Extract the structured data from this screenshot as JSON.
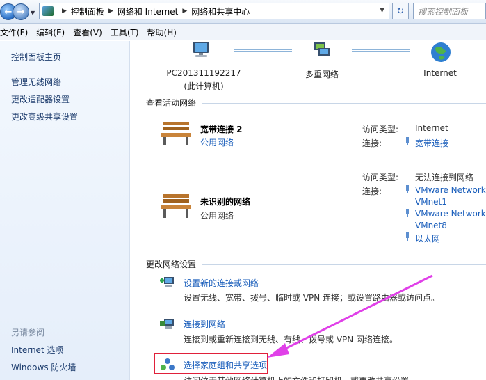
{
  "address_bar": {
    "breadcrumbs": [
      "控制面板",
      "网络和 Internet",
      "网络和共享中心"
    ],
    "search_placeholder": "搜索控制面板"
  },
  "menu": [
    "文件(F)",
    "编辑(E)",
    "查看(V)",
    "工具(T)",
    "帮助(H)"
  ],
  "sidebar": {
    "links": [
      "控制面板主页",
      "管理无线网络",
      "更改适配器设置",
      "更改高级共享设置"
    ],
    "see_also_header": "另请参阅",
    "see_also": [
      "Internet 选项",
      "Windows 防火墙"
    ]
  },
  "network_map": {
    "computer_name": "PC201311192217",
    "computer_sub": "(此计算机)",
    "middle_label": "多重网络",
    "internet_label": "Internet"
  },
  "active_networks": {
    "title": "查看活动网络",
    "networks": [
      {
        "name": "宽带连接  2",
        "type": "公用网络",
        "access_label": "访问类型:",
        "access_value": "Internet",
        "conn_label": "连接:",
        "connections": [
          "宽带连接"
        ]
      },
      {
        "name": "未识别的网络",
        "type": "公用网络",
        "access_label": "访问类型:",
        "access_value": "无法连接到网络",
        "conn_label": "连接:",
        "connections": [
          "VMware Network",
          "VMnet1",
          "VMware Network",
          "VMnet8",
          "以太网"
        ]
      }
    ]
  },
  "change_settings": {
    "title": "更改网络设置",
    "tasks": [
      {
        "link": "设置新的连接或网络",
        "desc": "设置无线、宽带、拨号、临时或 VPN 连接；或设置路由器或访问点。"
      },
      {
        "link": "连接到网络",
        "desc": "连接到或重新连接到无线、有线、拨号或 VPN 网络连接。"
      },
      {
        "link": "选择家庭组和共享选项",
        "desc": "访问位于其他网络计算机上的文件和打印机，或更改共享设置。"
      }
    ]
  },
  "colors": {
    "link": "#1a5ebb",
    "annotation_arrow": "#e040e8",
    "highlight_box": "#e0203a"
  }
}
